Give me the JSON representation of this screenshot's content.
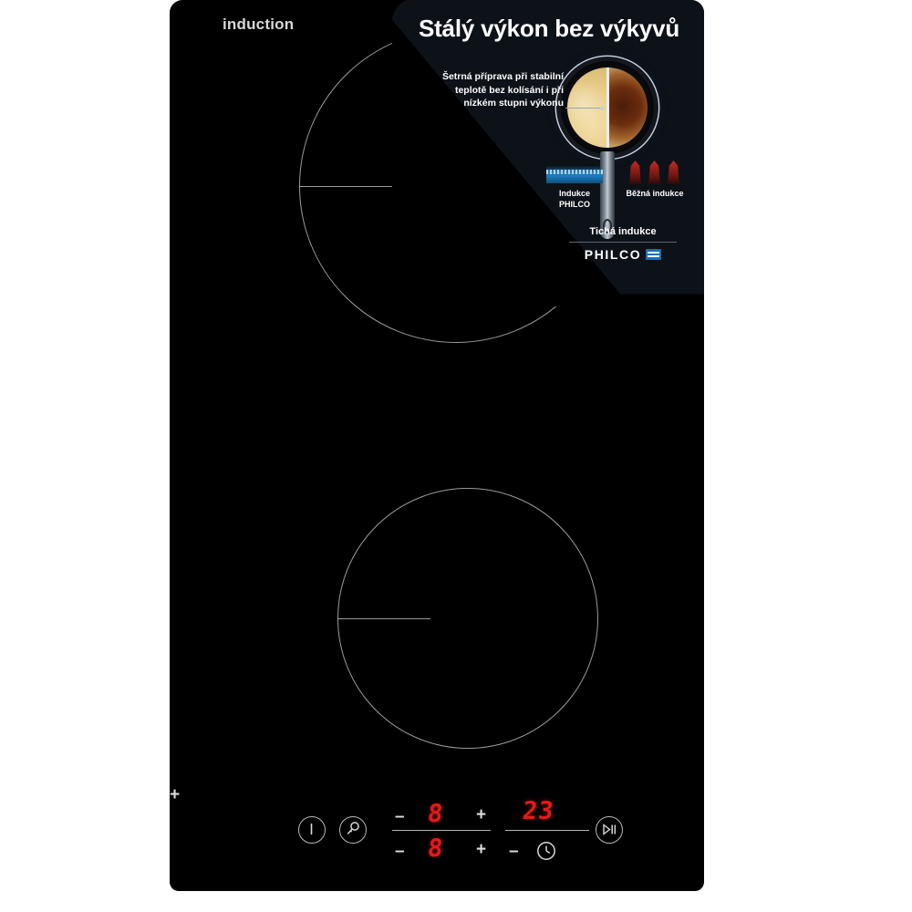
{
  "product": {
    "brand_label": "induction",
    "body_color": "#000000",
    "zone_outline_color": "#9a9a9a"
  },
  "zones": [
    {
      "name": "rear-cooking-zone",
      "label": ""
    },
    {
      "name": "front-cooking-zone",
      "label": ""
    }
  ],
  "promo": {
    "title": "Stálý výkon bez výkyvů",
    "description": "Šetrná příprava při stabilní teplotě bez kolísání i při nízkém stupni výkonu",
    "indicator_left": "Indukce PHILCO",
    "indicator_right": "Běžná indukce",
    "tagline": "Tichá indukce",
    "logo_text": "PHILCO",
    "bg_color": "#0d1118",
    "accent_color": "#1a6fb5"
  },
  "controls": {
    "power_icon": "power-icon",
    "lock_icon": "key-lock-icon",
    "pause_icon": "play-pause-icon",
    "clock_icon": "clock-icon",
    "minus": "–",
    "plus": "+",
    "burner_rear_value": "8",
    "burner_front_value": "8",
    "timer_value": "23",
    "led_color": "#e01b1b"
  }
}
